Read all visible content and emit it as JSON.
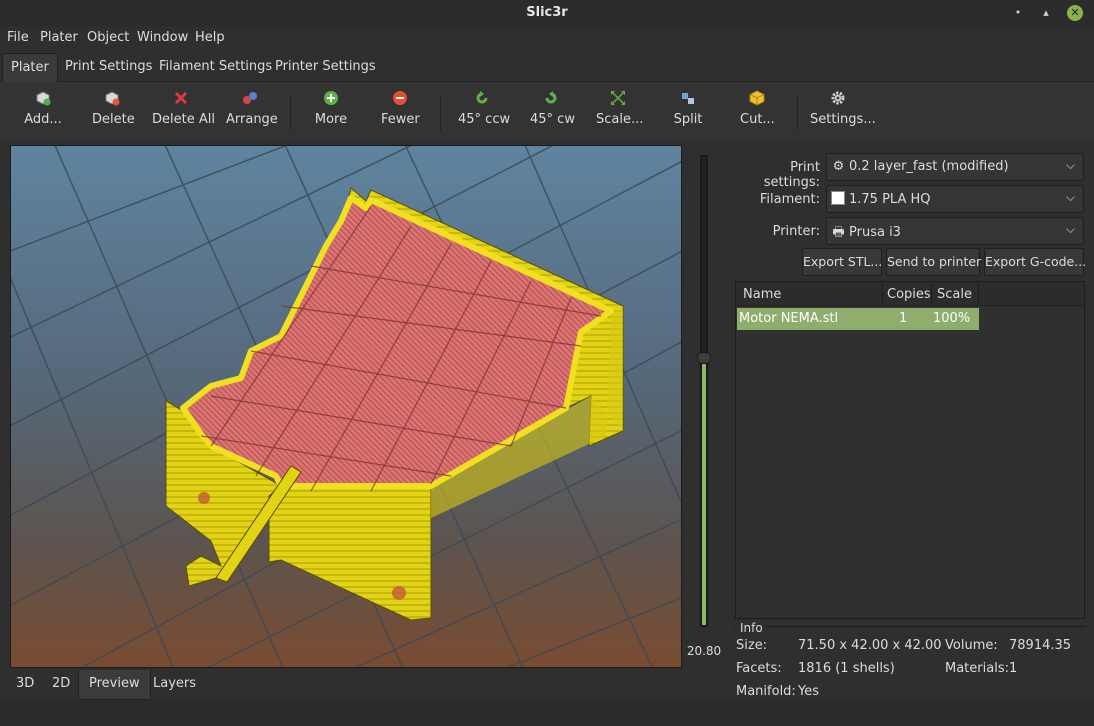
{
  "window": {
    "title": "Slic3r",
    "minimize_glyph": "•",
    "maximize_glyph": "▴",
    "close_glyph": "✕"
  },
  "menu": [
    "File",
    "Plater",
    "Object",
    "Window",
    "Help"
  ],
  "tabs": [
    "Plater",
    "Print Settings",
    "Filament Settings",
    "Printer Settings"
  ],
  "toolbar": [
    {
      "label": "Add...",
      "icon": "add-icon"
    },
    {
      "label": "Delete",
      "icon": "delete-icon"
    },
    {
      "label": "Delete All",
      "icon": "delete-all-icon"
    },
    {
      "label": "Arrange",
      "icon": "arrange-icon"
    },
    {
      "label": "More",
      "icon": "plus-icon"
    },
    {
      "label": "Fewer",
      "icon": "minus-icon"
    },
    {
      "label": "45° ccw",
      "icon": "rotate-ccw-icon"
    },
    {
      "label": "45° cw",
      "icon": "rotate-cw-icon"
    },
    {
      "label": "Scale...",
      "icon": "scale-icon"
    },
    {
      "label": "Split",
      "icon": "split-icon"
    },
    {
      "label": "Cut...",
      "icon": "cut-icon"
    },
    {
      "label": "Settings...",
      "icon": "gear-icon"
    }
  ],
  "layer_slider": {
    "value": "20.80",
    "level_fraction": 0.57
  },
  "view_tabs": [
    "3D",
    "2D",
    "Preview",
    "Layers"
  ],
  "settings": {
    "print_label": "Print settings:",
    "print_value": "0.2 layer_fast (modified)",
    "filament_label": "Filament:",
    "filament_value": "1.75 PLA HQ",
    "printer_label": "Printer:",
    "printer_value": "Prusa i3",
    "arrow": "⌵",
    "gear_glyph": "⚙",
    "printer_glyph": "🖶"
  },
  "actions": {
    "export_stl": "Export STL...",
    "send": "Send to printer",
    "export_gcode": "Export G-code..."
  },
  "object_list": {
    "columns": [
      "Name",
      "Copies",
      "Scale"
    ],
    "rows": [
      {
        "name": "Motor NEMA.stl",
        "copies": "1",
        "scale": "100%"
      }
    ]
  },
  "info": {
    "title": "Info",
    "size_label": "Size:",
    "size_value": "71.50 x 42.00 x 42.00",
    "volume_label": "Volume:",
    "volume_value": "78914.35",
    "facets_label": "Facets:",
    "facets_value": "1816 (1 shells)",
    "materials_label": "Materials:",
    "materials_value": "1",
    "manifold_label": "Manifold:",
    "manifold_value": "Yes"
  },
  "colors": {
    "accent": "#8cb46c",
    "perimeter": "#e8dc14",
    "infill": "#d96b6b",
    "bed_top": "#5c7e96",
    "bed_bottom": "#7a4a2e"
  }
}
